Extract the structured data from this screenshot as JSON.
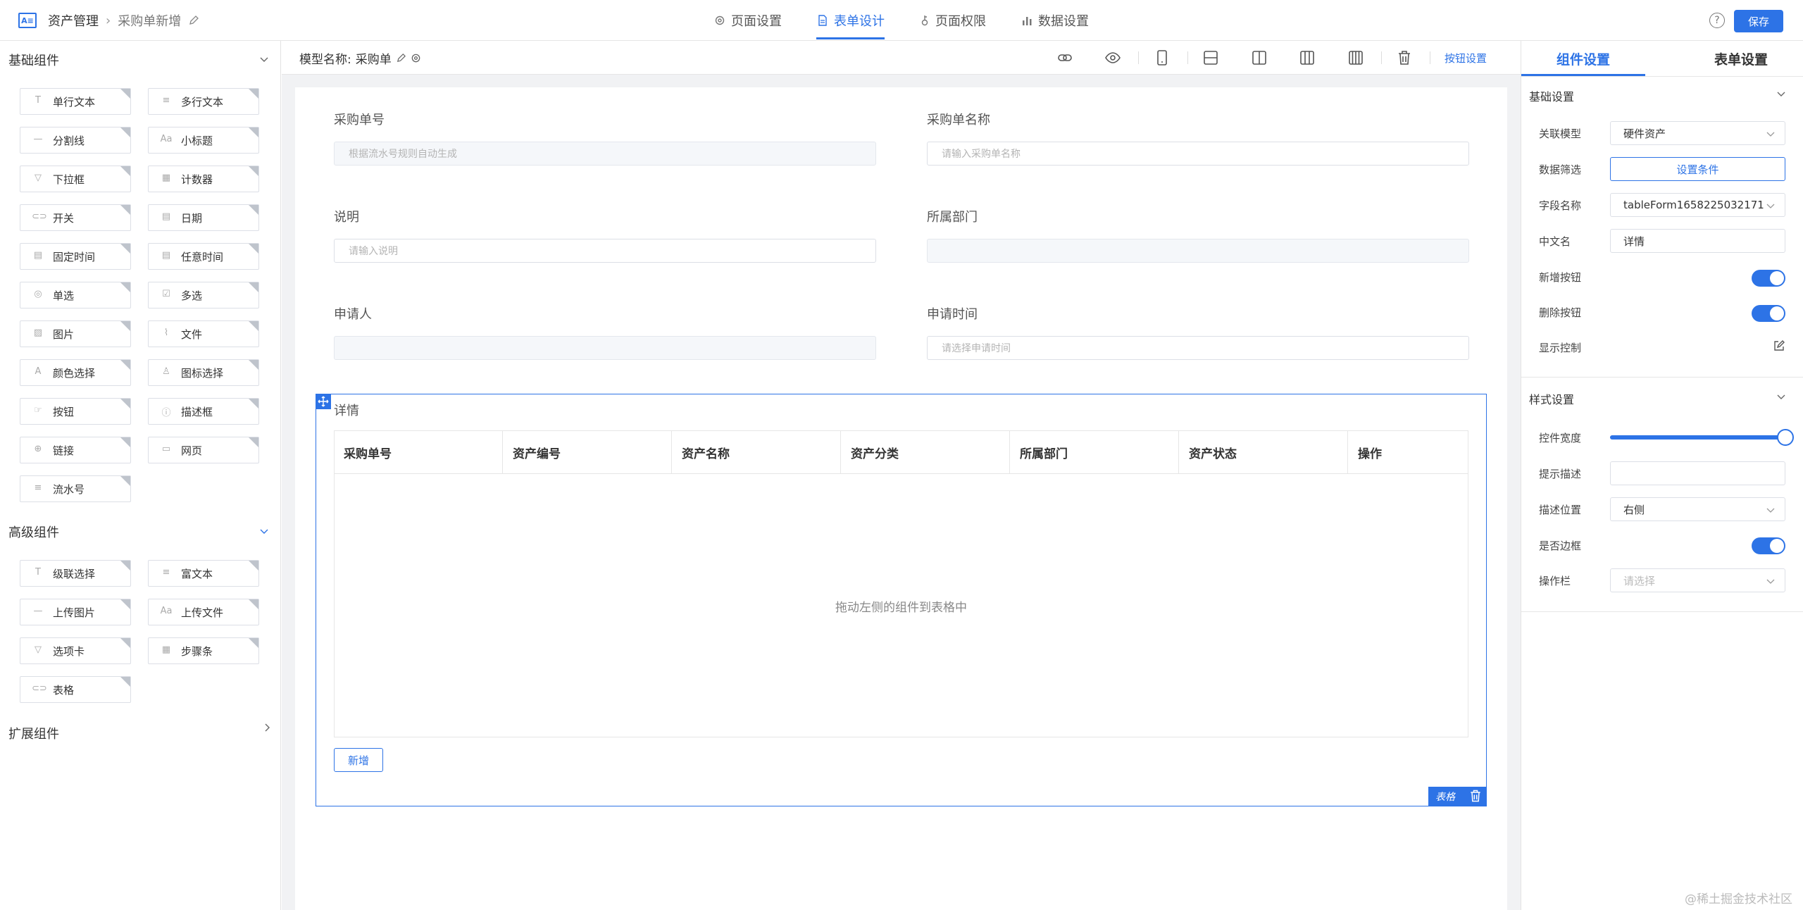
{
  "header": {
    "app_name": "资产管理",
    "page_name": "采购单新增",
    "tabs": [
      {
        "label": "页面设置",
        "icon": "gear-icon"
      },
      {
        "label": "表单设计",
        "icon": "document-icon"
      },
      {
        "label": "页面权限",
        "icon": "key-icon"
      },
      {
        "label": "数据设置",
        "icon": "bar-chart-icon"
      }
    ],
    "active_tab": "表单设计",
    "save_label": "保存"
  },
  "left_panel": {
    "basic_title": "基础组件",
    "basic_items": [
      "单行文本",
      "多行文本",
      "分割线",
      "小标题",
      "下拉框",
      "计数器",
      "开关",
      "日期",
      "固定时间",
      "任意时间",
      "单选",
      "多选",
      "图片",
      "文件",
      "颜色选择",
      "图标选择",
      "按钮",
      "描述框",
      "链接",
      "网页",
      "流水号"
    ],
    "advanced_title": "高级组件",
    "advanced_items": [
      "级联选择",
      "富文本",
      "上传图片",
      "上传文件",
      "选项卡",
      "步骤条",
      "表格"
    ],
    "extend_title": "扩展组件"
  },
  "toolbar": {
    "model_label": "模型名称:",
    "model_name": "采购单",
    "button_settings": "按钮设置"
  },
  "form": {
    "fields": [
      {
        "label": "采购单号",
        "placeholder": "根据流水号规则自动生成",
        "disabled": true
      },
      {
        "label": "采购单名称",
        "placeholder": "请输入采购单名称",
        "disabled": false
      },
      {
        "label": "说明",
        "placeholder": "请输入说明",
        "disabled": false
      },
      {
        "label": "所属部门",
        "placeholder": "",
        "disabled": true
      },
      {
        "label": "申请人",
        "placeholder": "",
        "disabled": true
      },
      {
        "label": "申请时间",
        "placeholder": "请选择申请时间",
        "disabled": false
      }
    ],
    "table": {
      "title": "详情",
      "columns": [
        "采购单号",
        "资产编号",
        "资产名称",
        "资产分类",
        "所属部门",
        "资产状态",
        "操作"
      ],
      "empty_text": "拖动左侧的组件到表格中",
      "add_label": "新增",
      "tag_label": "表格"
    }
  },
  "right_panel": {
    "tabs": [
      "组件设置",
      "表单设置"
    ],
    "basic_section": "基础设置",
    "basic_rows": [
      {
        "label": "关联模型",
        "value": "硬件资产"
      },
      {
        "label": "数据筛选",
        "value": "设置条件"
      },
      {
        "label": "字段名称",
        "value": "tableForm1658225032171"
      },
      {
        "label": "中文名",
        "value": "详情"
      },
      {
        "label": "新增按钮",
        "value": "on"
      },
      {
        "label": "删除按钮",
        "value": "on"
      },
      {
        "label": "显示控制",
        "value": ""
      }
    ],
    "style_section": "样式设置",
    "style_rows": [
      {
        "label": "控件宽度",
        "value": 1.0
      },
      {
        "label": "提示描述",
        "value": ""
      },
      {
        "label": "描述位置",
        "value": "右侧"
      },
      {
        "label": "是否边框",
        "value": "on"
      },
      {
        "label": "操作栏",
        "value": "请选择"
      }
    ]
  },
  "watermark": "@稀土掘金技术社区",
  "colors": {
    "accent": "#2d73e6",
    "canvas_bg": "#f1f2f4"
  }
}
